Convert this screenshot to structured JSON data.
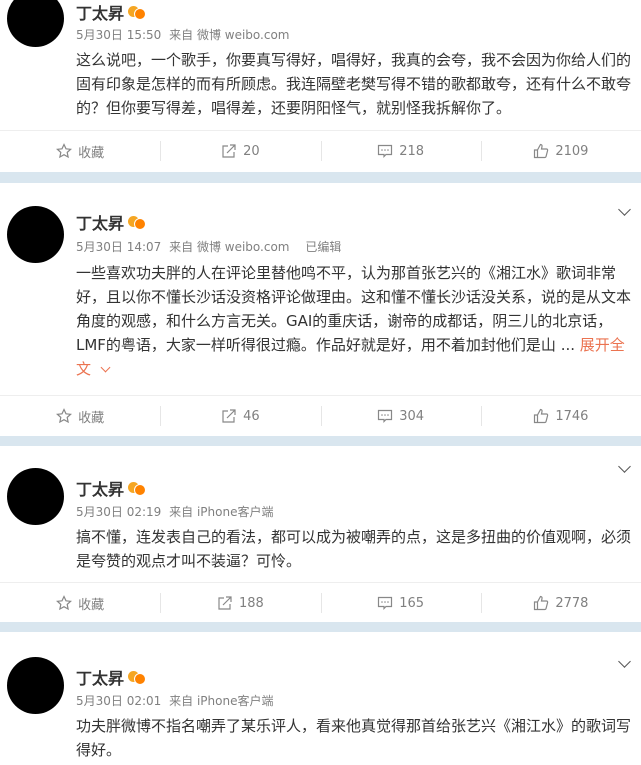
{
  "posts": [
    {
      "author": "丁太昇",
      "date": "5月30日 15:50",
      "source": "来自 微博 weibo.com",
      "edited": "",
      "text": "这么说吧，一个歌手，你要真写得好，唱得好，我真的会夸，我不会因为你给人们的固有印象是怎样的而有所顾虑。我连隔壁老樊写得不错的歌都敢夸，还有什么不敢夸的？但你要写得差，唱得差，还要阴阳怪气，就别怪我拆解你了。",
      "expand": "",
      "actions": {
        "favorite": "收藏",
        "repost": "20",
        "comment": "218",
        "like": "2109"
      }
    },
    {
      "author": "丁太昇",
      "date": "5月30日 14:07",
      "source": "来自 微博 weibo.com",
      "edited": "已编辑",
      "text": "一些喜欢功夫胖的人在评论里替他鸣不平，认为那首张艺兴的《湘江水》歌词非常好，且以你不懂长沙话没资格评论做理由。这和懂不懂长沙话没关系，说的是从文本角度的观感，和什么方言无关。GAI的重庆话，谢帝的成都话，阴三儿的北京话，LMF的粤语，大家一样听得很过瘾。作品好就是好，用不着加封他们是山 ...",
      "expand": "展开全文",
      "actions": {
        "favorite": "收藏",
        "repost": "46",
        "comment": "304",
        "like": "1746"
      }
    },
    {
      "author": "丁太昇",
      "date": "5月30日 02:19",
      "source": "来自 iPhone客户端",
      "edited": "",
      "text": "搞不懂，连发表自己的看法，都可以成为被嘲弄的点，这是多扭曲的价值观啊，必须是夸赞的观点才叫不装逼？可怜。",
      "expand": "",
      "actions": {
        "favorite": "收藏",
        "repost": "188",
        "comment": "165",
        "like": "2778"
      }
    },
    {
      "author": "丁太昇",
      "date": "5月30日 02:01",
      "source": "来自 iPhone客户端",
      "edited": "",
      "text": "功夫胖微博不指名嘲弄了某乐评人，看来他真觉得那首给张艺兴《湘江水》的歌词写得好。",
      "expand": "",
      "actions": null
    }
  ]
}
